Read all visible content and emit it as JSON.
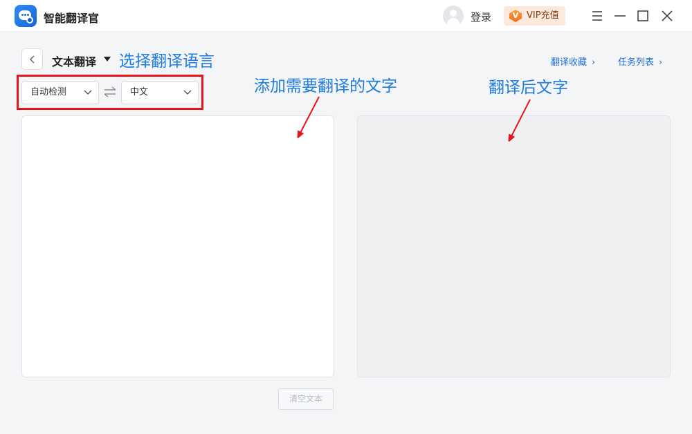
{
  "app": {
    "title": "智能翻译官"
  },
  "header": {
    "login_label": "登录",
    "vip_label": "VIP充值",
    "vip_icon_letter": "V"
  },
  "toolbar": {
    "mode_label": "文本翻译",
    "favorites_link": "翻译收藏",
    "tasks_link": "任务列表"
  },
  "language": {
    "source": "自动检测",
    "target": "中文"
  },
  "annotations": {
    "select_language": "选择翻译语言",
    "add_text": "添加需要翻译的文字",
    "translated_text": "翻译后文字"
  },
  "input_panel": {
    "text": ""
  },
  "output_panel": {
    "text": ""
  },
  "actions": {
    "clear_label": "清空文本"
  },
  "colors": {
    "accent": "#1f6fd8",
    "annotation": "#1e7be0",
    "highlight_box": "#e8141b",
    "vip_bg": "#fde9dc"
  }
}
